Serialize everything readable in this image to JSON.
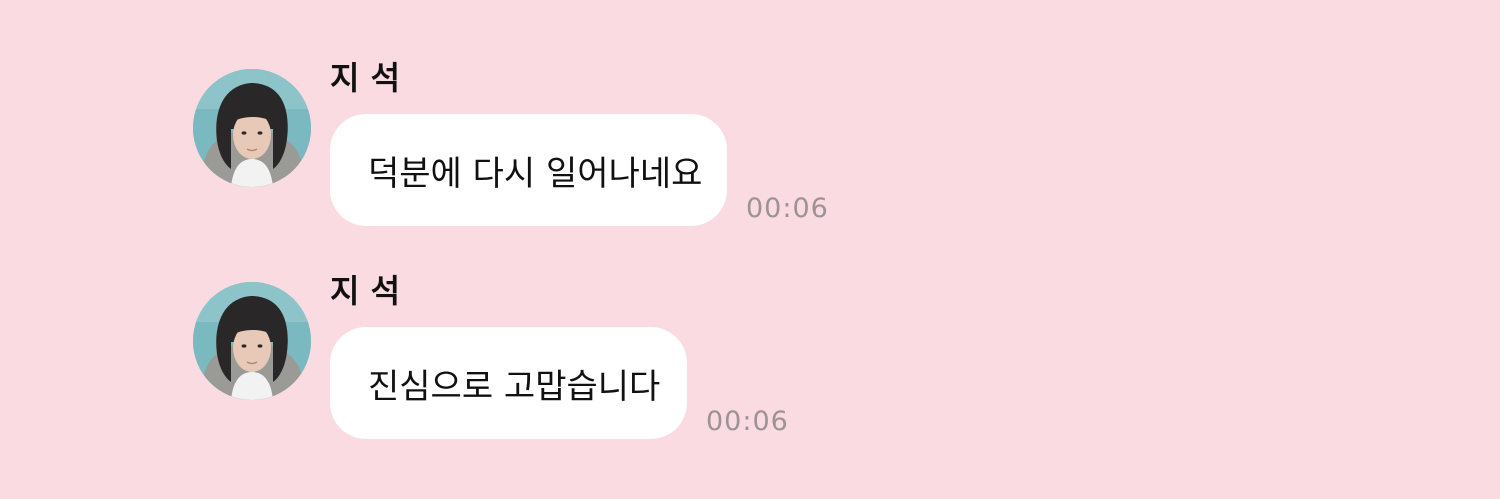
{
  "messages": [
    {
      "sender": "지 석",
      "text": "덕분에 다시 일어나네요",
      "time": "00:06",
      "avatar_icon": "profile-photo"
    },
    {
      "sender": "지 석",
      "text": "진심으로 고맙습니다",
      "time": "00:06",
      "avatar_icon": "profile-photo"
    }
  ],
  "colors": {
    "background": "#fadbe1",
    "bubble": "#ffffff",
    "text": "#111111",
    "timestamp": "#9d9396"
  }
}
